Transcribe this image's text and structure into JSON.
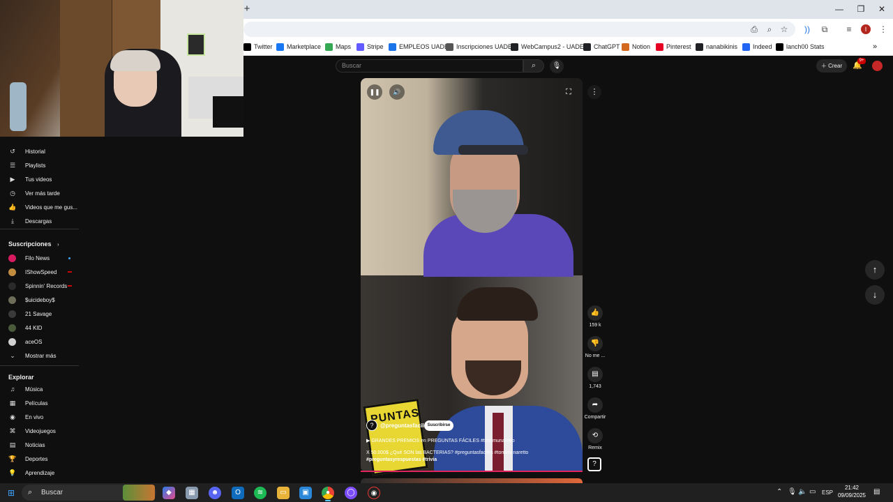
{
  "browser": {
    "bookmarks": [
      {
        "label": "Twitter",
        "icon": "x-icon",
        "color": "#000000"
      },
      {
        "label": "Marketplace",
        "icon": "facebook-icon",
        "color": "#1877f2"
      },
      {
        "label": "Maps",
        "icon": "maps-icon",
        "color": "#34a853"
      },
      {
        "label": "Stripe",
        "icon": "stripe-icon",
        "color": "#635bff"
      },
      {
        "label": "EMPLEOS UADE",
        "icon": "uade-icon",
        "color": "#1a73e8"
      },
      {
        "label": "Inscripciones UADE",
        "icon": "uade-icon",
        "color": "#555555"
      },
      {
        "label": "WebCampus2 - UADE",
        "icon": "globe-icon",
        "color": "#202124"
      },
      {
        "label": "ChatGPT",
        "icon": "chatgpt-icon",
        "color": "#202124"
      },
      {
        "label": "Notion",
        "icon": "notion-icon",
        "color": "#d2691e"
      },
      {
        "label": "Pinterest",
        "icon": "pinterest-icon",
        "color": "#e60023"
      },
      {
        "label": "nanabikinis",
        "icon": "globe-icon",
        "color": "#202124"
      },
      {
        "label": "Indeed",
        "icon": "indeed-icon",
        "color": "#2164f3"
      },
      {
        "label": "lanch00 Stats",
        "icon": "stats-icon",
        "color": "#000000"
      }
    ],
    "more": "»",
    "profile_initial": "I"
  },
  "youtube": {
    "search_placeholder": "Buscar",
    "create_label": "Crear",
    "notif_badge": "9+",
    "sidebar": {
      "you_items": [
        {
          "label": "Historial",
          "icon": "history-icon"
        },
        {
          "label": "Playlists",
          "icon": "playlist-icon"
        },
        {
          "label": "Tus videos",
          "icon": "video-icon"
        },
        {
          "label": "Ver más tarde",
          "icon": "clock-icon"
        },
        {
          "label": "Videos que me gus...",
          "icon": "thumbs-up-icon"
        },
        {
          "label": "Descargas",
          "icon": "download-icon"
        }
      ],
      "subs_title": "Suscripciones",
      "subs": [
        {
          "label": "Filo News",
          "color": "#d81b60",
          "marker": "dot"
        },
        {
          "label": "IShowSpeed",
          "color": "#c28d3e",
          "marker": "live"
        },
        {
          "label": "Spinnin' Records",
          "color": "#2a2a2a",
          "marker": "live"
        },
        {
          "label": "$uicideboy$",
          "color": "#6d6d5a",
          "marker": ""
        },
        {
          "label": "21 Savage",
          "color": "#3a3a3a",
          "marker": ""
        },
        {
          "label": "44 KID",
          "color": "#4a5a3a",
          "marker": ""
        },
        {
          "label": "aceOS",
          "color": "#d0d0d0",
          "marker": ""
        }
      ],
      "show_more": "Mostrar más",
      "explore_title": "Explorar",
      "explore": [
        {
          "label": "Música",
          "icon": "music-icon"
        },
        {
          "label": "Películas",
          "icon": "film-icon"
        },
        {
          "label": "En vivo",
          "icon": "live-icon"
        },
        {
          "label": "Videojuegos",
          "icon": "gamepad-icon"
        },
        {
          "label": "Noticias",
          "icon": "news-icon"
        },
        {
          "label": "Deportes",
          "icon": "trophy-icon"
        },
        {
          "label": "Aprendizaje",
          "icon": "bulb-icon"
        }
      ]
    },
    "short": {
      "channel": "@preguntasfaciles",
      "subscribe": "Suscribirse",
      "book_text": "PUNTAS",
      "playlist": "GRANDES PREMIOS en PREGUNTAS FÁCILES #tomimunaretto",
      "desc_line1": "X 50.000$ ¿Qué SON las BACTERIAS? #preguntasfaciles #tomimunaretto",
      "desc_line2": "#preguntasyrespuestas #trivia",
      "likes": "159 k",
      "dislike": "No me ...",
      "comments": "1,743",
      "share": "Compartir",
      "remix": "Remix"
    }
  },
  "taskbar": {
    "search_label": "Buscar",
    "lang": "ESP",
    "time": "21:42",
    "date": "09/09/2025"
  }
}
